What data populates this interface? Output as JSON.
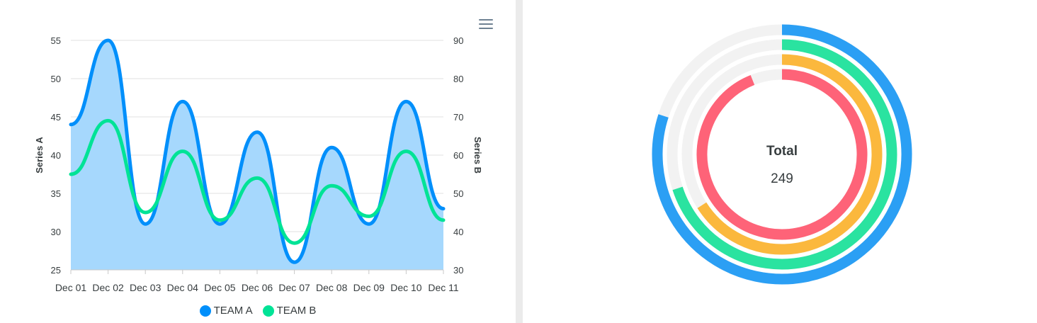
{
  "chart_data": [
    {
      "type": "area",
      "categories": [
        "Dec 01",
        "Dec 02",
        "Dec 03",
        "Dec 04",
        "Dec 05",
        "Dec 06",
        "Dec 07",
        "Dec 08",
        "Dec 09",
        "Dec 10",
        "Dec 11"
      ],
      "series": [
        {
          "name": "TEAM A",
          "type": "area",
          "axis": "left",
          "color": "#008ffb",
          "values": [
            44,
            55,
            31,
            47,
            31,
            43,
            26,
            41,
            31,
            47,
            33
          ]
        },
        {
          "name": "TEAM B",
          "type": "line",
          "axis": "right",
          "color": "#00e396",
          "values": [
            55,
            69,
            45,
            61,
            43,
            54,
            37,
            52,
            44,
            61,
            43
          ]
        }
      ],
      "ylabel": "Series A",
      "y2label": "Series B",
      "ylim": [
        25,
        55
      ],
      "yticks": [
        25,
        30,
        35,
        40,
        45,
        50,
        55
      ],
      "y2lim": [
        30,
        90
      ],
      "y2ticks": [
        30,
        40,
        50,
        60,
        70,
        80,
        90
      ],
      "area_fill": "#a6d8fd",
      "grid": true,
      "legend": "bottom-center"
    },
    {
      "type": "radialBar",
      "center_label": "Total",
      "center_value": "249",
      "track_color": "#f2f2f2",
      "series": [
        {
          "value": 0.8,
          "color": "#2b9ff4"
        },
        {
          "value": 0.7,
          "color": "#2ae3a0"
        },
        {
          "value": 0.66,
          "color": "#fbb83d"
        },
        {
          "value": 0.94,
          "color": "#fe6378"
        }
      ]
    }
  ],
  "toolbar": {
    "menu_icon": "hamburger-menu-icon"
  }
}
